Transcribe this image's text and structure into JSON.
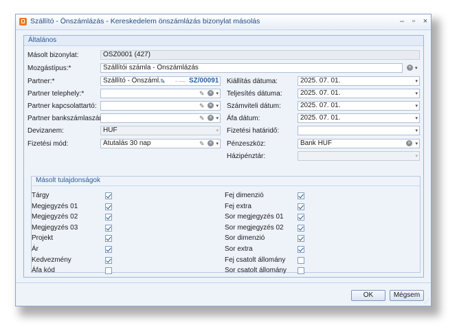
{
  "window": {
    "title": "Szállító - Önszámlázás - Kereskedelem önszámlázás bizonylat másolás",
    "minimize": "–",
    "maximize": "▫",
    "close": "×"
  },
  "general": {
    "header": "Általános",
    "masolt_label": "Másolt bizonylat:",
    "masolt_value": "ÖSZ0001 (427)",
    "mozgastipus_label": "Mozgástípus:*",
    "mozgastipus_value": "Szállítói számla - Önszámlázás",
    "partner_label": "Partner:*",
    "partner_value": "Szállító - Önszáml...",
    "partner_code": "SZ/00091",
    "partner_telephely_label": "Partner telephely:*",
    "partner_kapcsolattarto_label": "Partner kapcsolattartó:",
    "partner_bankszamla_label": "Partner bankszámlaszám:",
    "devizanem_label": "Devizanem:",
    "devizanem_value": "HUF",
    "fizetesi_mod_label": "Fizetési mód:",
    "fizetesi_mod_value": "Átutalás 30 nap",
    "kiallitas_label": "Kiállítás dátuma:",
    "kiallitas_value": "2025. 07. 01.",
    "teljesites_label": "Teljesítés dátuma:",
    "teljesites_value": "2025. 07. 01.",
    "szamviteli_label": "Számviteli dátum:",
    "szamviteli_value": "2025. 07. 01.",
    "afa_datum_label": "Áfa dátum:",
    "afa_datum_value": "2025. 07. 01.",
    "fizetesi_hatarido_label": "Fizetési határidő:",
    "fizetesi_hatarido_value": "",
    "penzeszkoz_label": "Pénzeszköz:",
    "penzeszkoz_value": "Bank HUF",
    "hazipenztar_label": "Házipénztár:",
    "hazipenztar_value": ""
  },
  "copied_properties": {
    "header": "Másolt tulajdonságok",
    "left": [
      {
        "label": "Tárgy",
        "checked": true
      },
      {
        "label": "Megjegyzés 01",
        "checked": true
      },
      {
        "label": "Megjegyzés 02",
        "checked": true
      },
      {
        "label": "Megjegyzés 03",
        "checked": true
      },
      {
        "label": "Projekt",
        "checked": true
      },
      {
        "label": "Ár",
        "checked": true
      },
      {
        "label": "Kedvezmény",
        "checked": true
      },
      {
        "label": "Áfa kód",
        "checked": false
      }
    ],
    "right": [
      {
        "label": "Fej dimenzió",
        "checked": true
      },
      {
        "label": "Fej extra",
        "checked": true
      },
      {
        "label": "Sor megjegyzés 01",
        "checked": true
      },
      {
        "label": "Sor megjegyzés 02",
        "checked": true
      },
      {
        "label": "Sor dimenzió",
        "checked": true
      },
      {
        "label": "Sor extra",
        "checked": true
      },
      {
        "label": "Fej csatolt állomány",
        "checked": false
      },
      {
        "label": "Sor csatolt állomány",
        "checked": false
      }
    ]
  },
  "buttons": {
    "ok": "OK",
    "cancel": "Mégsem"
  },
  "icons": {
    "dropdown": "▾",
    "clear": "×",
    "edit": "✎"
  }
}
